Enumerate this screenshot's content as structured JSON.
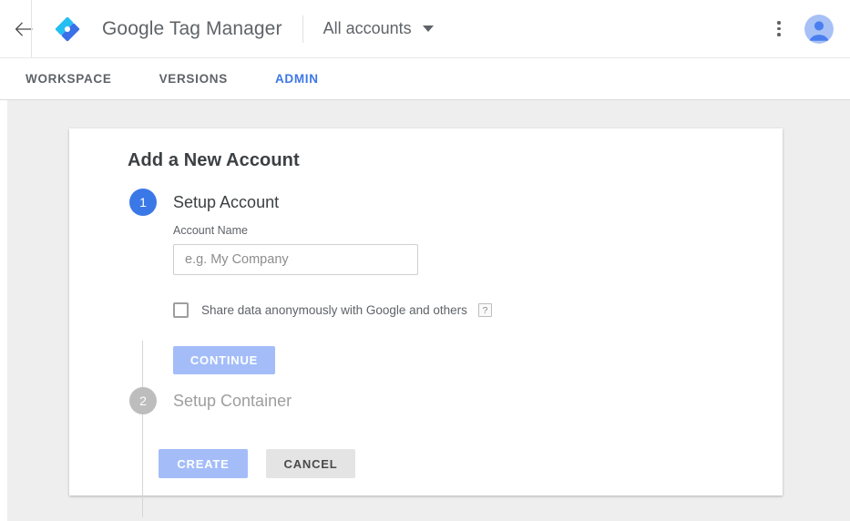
{
  "header": {
    "back_icon": "arrow-left-icon",
    "logo_icon": "google-tag-manager-logo",
    "brand_google": "Google",
    "brand_product": " Tag Manager",
    "account_selector": "All accounts",
    "account_caret_icon": "chevron-down-icon",
    "more_icon": "kebab-menu-icon",
    "avatar_icon": "user-avatar-icon"
  },
  "tabs": [
    {
      "label": "WORKSPACE",
      "active": false
    },
    {
      "label": "VERSIONS",
      "active": false
    },
    {
      "label": "ADMIN",
      "active": true
    }
  ],
  "card": {
    "title": "Add a New Account",
    "steps": [
      {
        "number": "1",
        "label": "Setup Account",
        "state": "active"
      },
      {
        "number": "2",
        "label": "Setup Container",
        "state": "inactive"
      }
    ],
    "form": {
      "account_name_label": "Account Name",
      "account_name_value": "",
      "account_name_placeholder": "e.g. My Company",
      "share_data_label": "Share data anonymously with Google and others",
      "share_data_checked": false,
      "help_icon_label": "?",
      "continue_label": "CONTINUE"
    },
    "footer": {
      "create_label": "CREATE",
      "cancel_label": "CANCEL"
    }
  },
  "colors": {
    "accent_blue": "#3b78e7",
    "tab_active_blue": "#3d77e8",
    "disabled_button_blue": "#a4bdf9",
    "cancel_gray": "#e4e4e4",
    "page_background": "#eeeeee",
    "card_background": "#ffffff",
    "step_inactive_gray": "#bdbdbd",
    "logo_light_blue": "#25BEF3",
    "logo_dark_blue": "#3A6FE8"
  }
}
